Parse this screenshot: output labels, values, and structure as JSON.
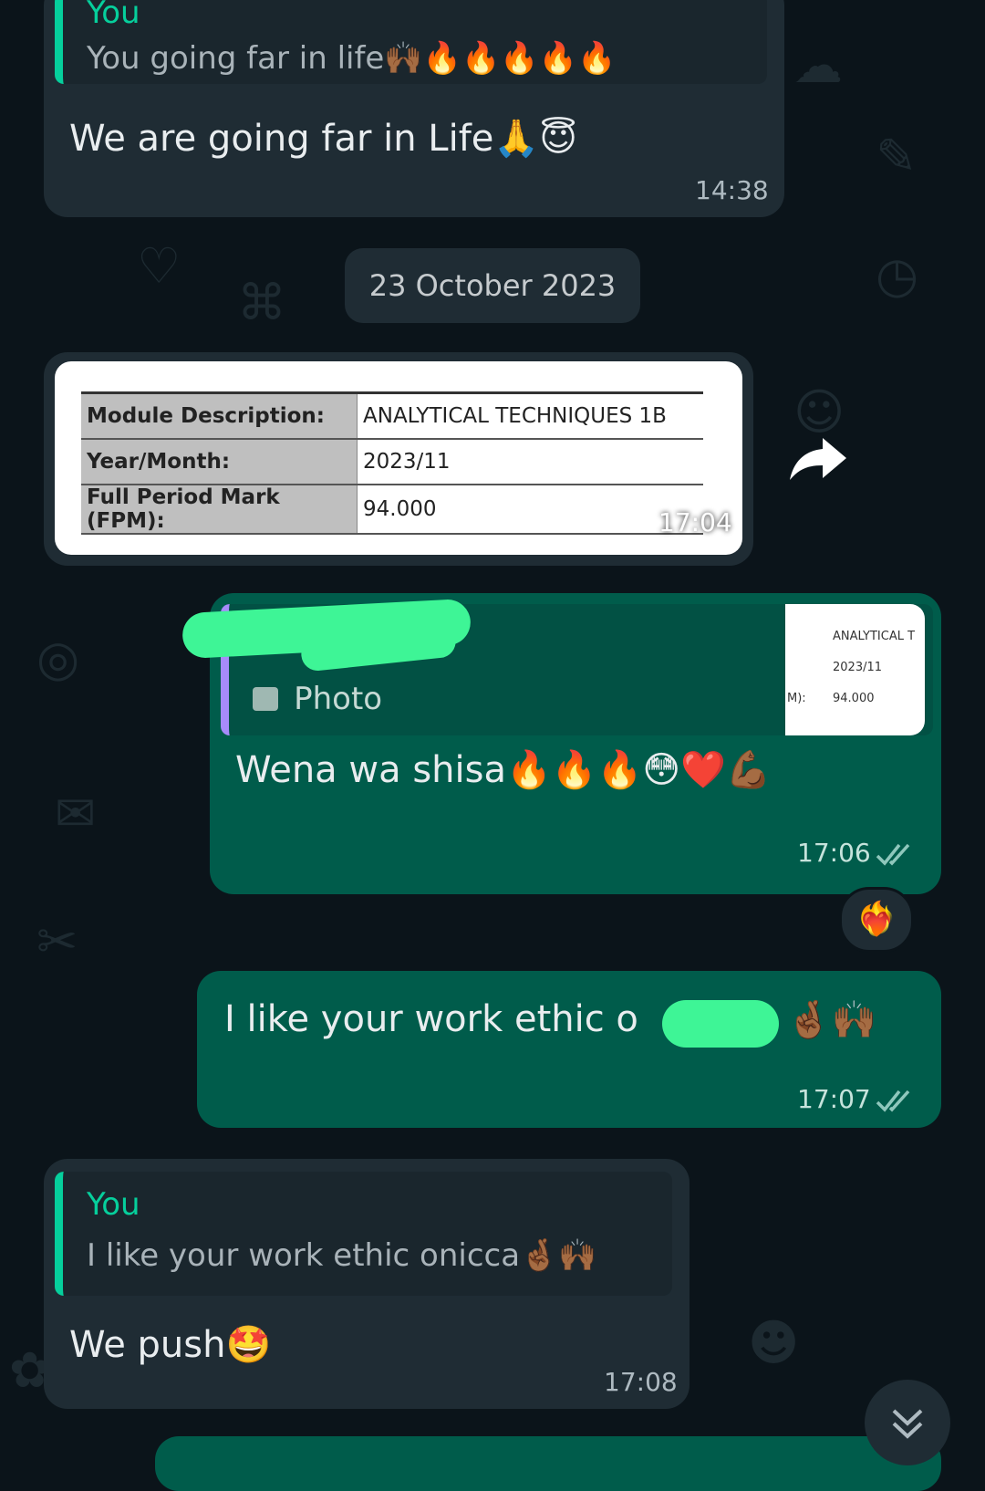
{
  "messages": {
    "first": {
      "quote_sender": "You",
      "quote_text": "You going far in life🙌🏾🔥🔥🔥🔥🔥",
      "text": "We are going far in Life🙏😇",
      "time": "14:38"
    },
    "date_separator": "23 October 2023",
    "image_message": {
      "rows": [
        {
          "label": "Module Description:",
          "value": "ANALYTICAL TECHNIQUES 1B"
        },
        {
          "label": "Year/Month:",
          "value": "2023/11"
        },
        {
          "label": "Full Period Mark (FPM):",
          "value": "94.000"
        }
      ],
      "time": "17:04"
    },
    "reply_photo": {
      "quote_type": "Photo",
      "thumb_lines": [
        "ANALYTICAL T",
        "2023/11",
        "94.000"
      ],
      "thumb_key": "M):",
      "text": "Wena wa shisa🔥🔥🔥😳❤️💪🏾",
      "time": "17:06",
      "reaction": "❤️‍🔥"
    },
    "work_ethic": {
      "text": "I like your work ethic o",
      "emoji": "🤞🏾🙌🏾",
      "time": "17:07"
    },
    "we_push": {
      "quote_sender": "You",
      "quote_text": "I like your work ethic onicca🤞🏾🙌🏾",
      "text": "We push🤩",
      "time": "17:08"
    }
  },
  "colors": {
    "background": "#0b141a",
    "incoming": "#1f2c34",
    "outgoing": "#005c4b",
    "accent": "#06cf9c",
    "read_ticks": "#53bdeb"
  },
  "icons": [
    "forward-icon",
    "double-check-icon",
    "photo-icon",
    "scroll-down-icon"
  ]
}
